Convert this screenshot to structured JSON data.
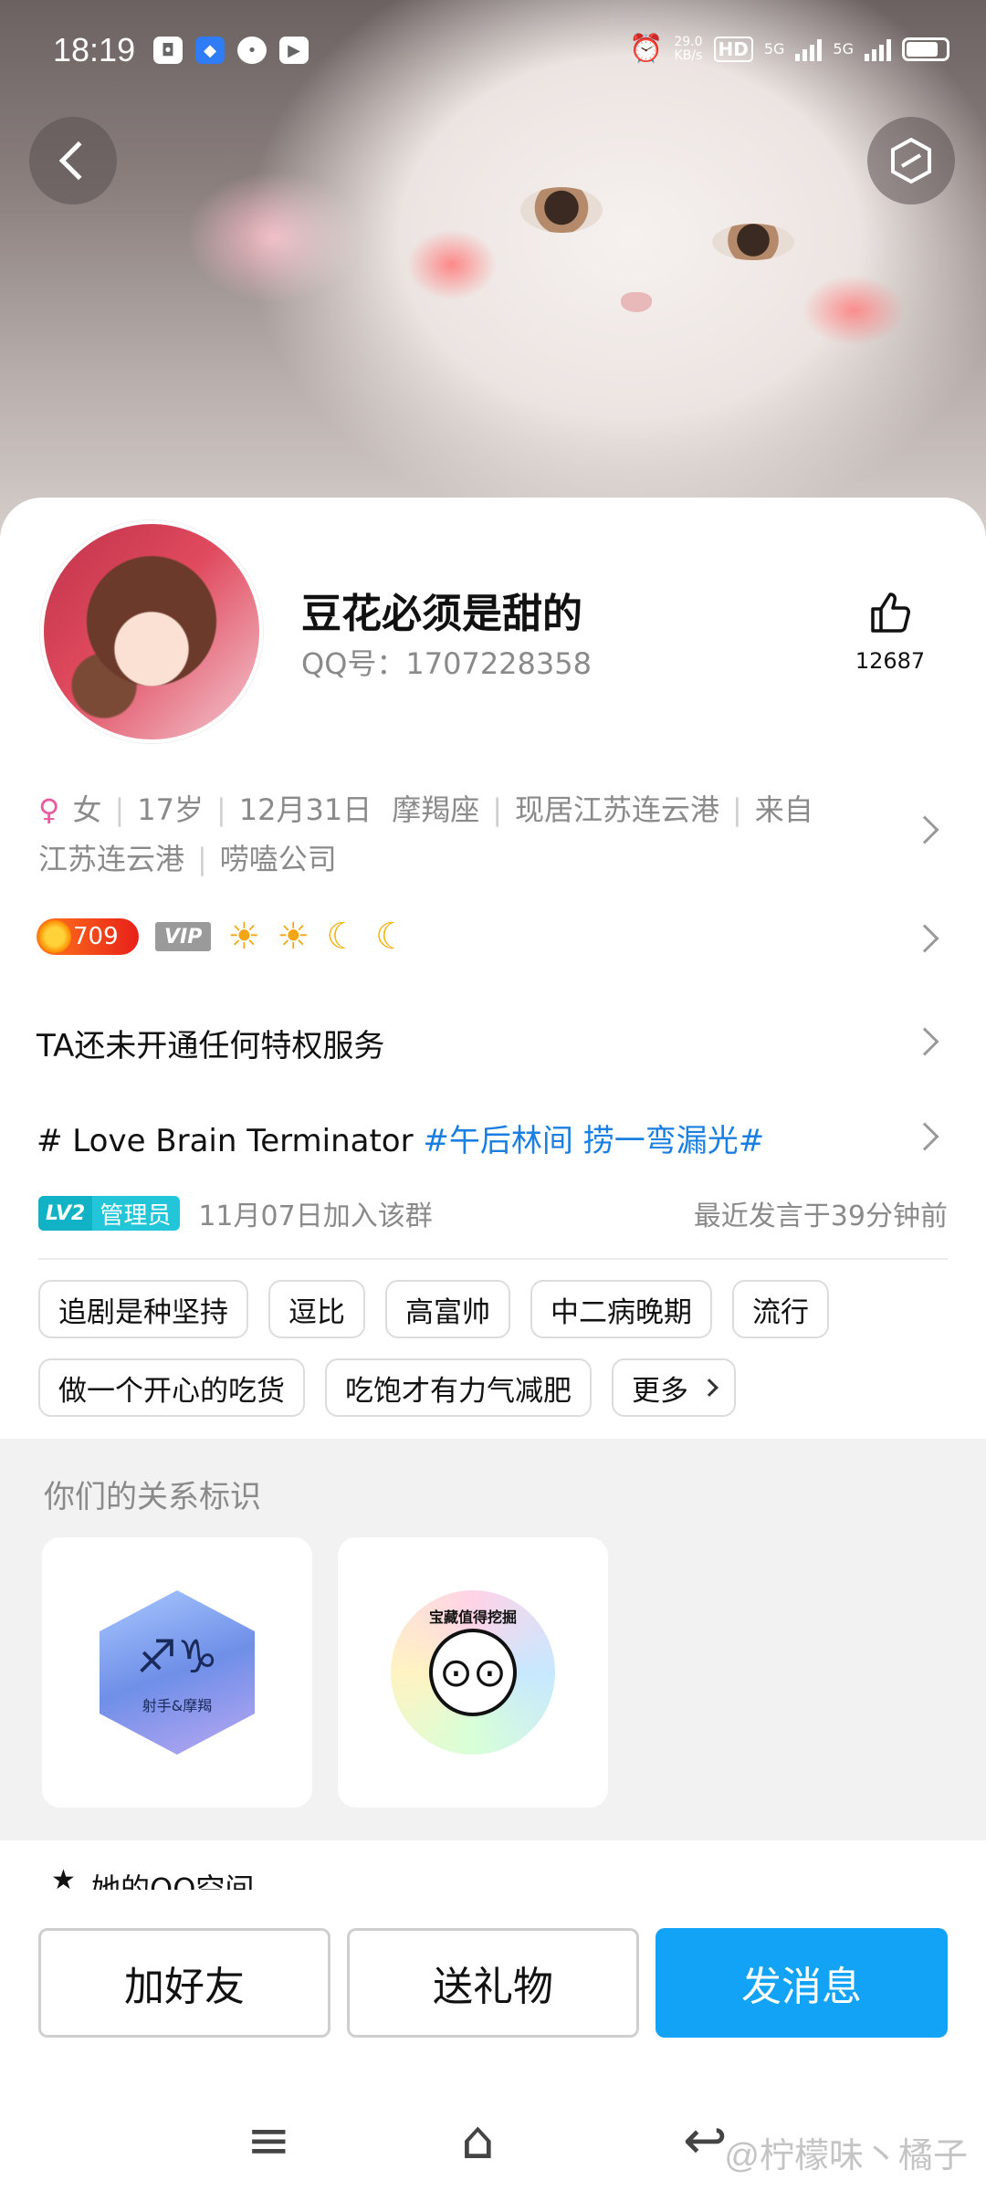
{
  "status_bar": {
    "time": "18:19",
    "net_speed_value": "29.0",
    "net_speed_unit": "KB/s",
    "hd_label": "HD",
    "sim1_label": "5G",
    "sim2_label": "5G"
  },
  "profile": {
    "nickname": "豆花必须是甜的",
    "qq_label": "QQ号：1707228358",
    "like_count": "12687",
    "gender": "女",
    "age": "17岁",
    "birthday": "12月31日",
    "zodiac": "摩羯座",
    "location": "现居江苏连云港",
    "hometown": "来自江苏连云港",
    "company": "唠嗑公司",
    "level_value": "709",
    "vip_label": "VIP",
    "privilege_text": "TA还未开通任何特权服务",
    "signature_prefix": "# Love Brain Terminator",
    "signature_topic": "#午后林间 捞一弯漏光#"
  },
  "group_info": {
    "level_tag": "LV2",
    "role": "管理员",
    "joined": "11月07日加入该群",
    "last_speak": "最近发言于39分钟前"
  },
  "tags": [
    "追剧是种坚持",
    "逗比",
    "高富帅",
    "中二病晚期",
    "流行",
    "做一个开心的吃货",
    "吃饱才有力气减肥"
  ],
  "tags_more_label": "更多",
  "relation": {
    "title": "你们的关系标识",
    "badge1_label": "射手&摩羯",
    "badge2_label": "宝藏值得挖掘"
  },
  "qzone_partial": "她的QQ空间",
  "actions": {
    "add_friend": "加好友",
    "send_gift": "送礼物",
    "send_message": "发消息"
  },
  "watermark": "@柠檬味丶橘子",
  "colors": {
    "primary": "#12a3f7",
    "topic": "#1a7fe0",
    "admin_badge": "#22c6d8",
    "gender": "#e75aa0"
  }
}
